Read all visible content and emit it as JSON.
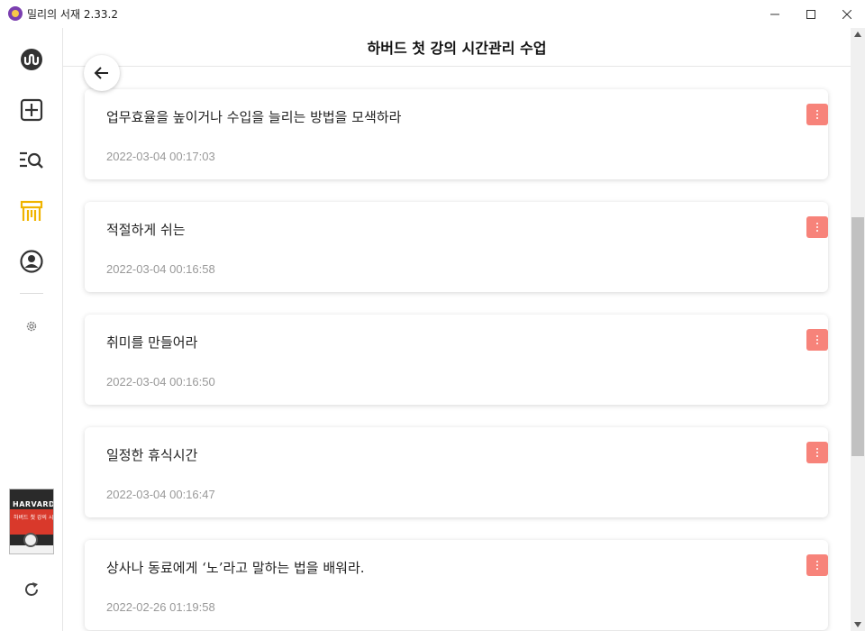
{
  "app": {
    "title": "밀리의 서재 2.33.2",
    "logo_icon": "millie-logo-icon"
  },
  "window_controls": [
    "minimize-icon",
    "maximize-icon",
    "close-icon"
  ],
  "sidebar": {
    "items": [
      {
        "name": "home",
        "icon": "millie-wave-icon",
        "color": "#333333"
      },
      {
        "name": "add",
        "icon": "plus-square-icon",
        "color": "#333333"
      },
      {
        "name": "search",
        "icon": "list-search-icon",
        "color": "#333333"
      },
      {
        "name": "library",
        "icon": "bookshelf-icon",
        "color": "#f0b400",
        "active": true
      },
      {
        "name": "profile",
        "icon": "user-circle-icon",
        "color": "#333333"
      }
    ],
    "settings_icon": "gear-icon",
    "book_cover": {
      "title": "HARVARD",
      "subtitle": "하버드 첫 강의 시간관리 수업"
    },
    "refresh_icon": "refresh-icon"
  },
  "header": {
    "title": "하버드 첫 강의 시간관리 수업",
    "back_icon": "arrow-left-icon"
  },
  "notes": [
    {
      "text": "업무효율을 높이거나 수입을 늘리는 방법을 모색하라",
      "date": "2022-03-04 00:17:03"
    },
    {
      "text": "적절하게 쉬는",
      "date": "2022-03-04 00:16:58"
    },
    {
      "text": "취미를 만들어라",
      "date": "2022-03-04 00:16:50"
    },
    {
      "text": "일정한 휴식시간",
      "date": "2022-03-04 00:16:47"
    },
    {
      "text": "상사나 동료에게 ‘노’라고 말하는 법을 배워라.",
      "date": "2022-02-26 01:19:58"
    }
  ],
  "colors": {
    "accent": "#f7837a",
    "active_nav": "#f0b400"
  }
}
